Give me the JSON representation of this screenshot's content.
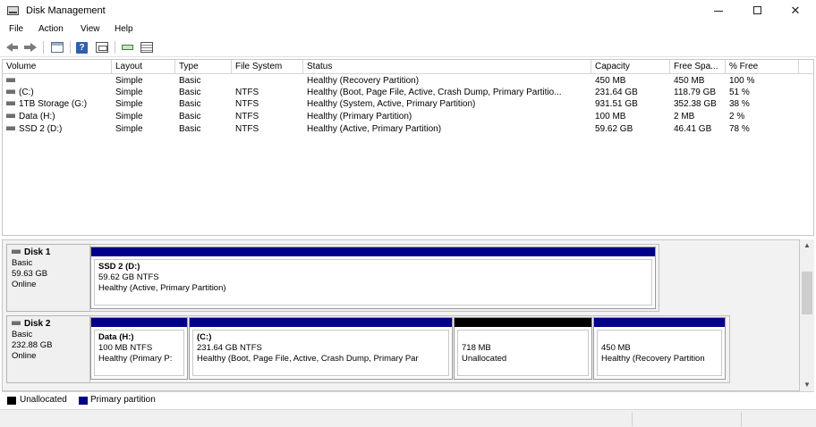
{
  "window": {
    "title": "Disk Management",
    "icons": [
      "disk-management-app-icon",
      "minimize-icon",
      "maximize-icon",
      "close-icon"
    ],
    "close_glyph": "✕"
  },
  "menu": [
    "File",
    "Action",
    "View",
    "Help"
  ],
  "toolbar": {
    "icons": [
      "back-arrow-icon",
      "forward-arrow-icon",
      "disk-list-icon",
      "help-icon",
      "properties-panel-icon",
      "connect-icon",
      "detail-list-icon"
    ],
    "help_glyph": "?"
  },
  "volume_table": {
    "columns": [
      "Volume",
      "Layout",
      "Type",
      "File System",
      "Status",
      "Capacity",
      "Free Spa...",
      "% Free"
    ],
    "rows": [
      {
        "volume": "",
        "layout": "Simple",
        "type": "Basic",
        "fs": "",
        "status": "Healthy (Recovery Partition)",
        "capacity": "450 MB",
        "free": "450 MB",
        "pct": "100 %"
      },
      {
        "volume": "(C:)",
        "layout": "Simple",
        "type": "Basic",
        "fs": "NTFS",
        "status": "Healthy (Boot, Page File, Active, Crash Dump, Primary Partitio...",
        "capacity": "231.64 GB",
        "free": "118.79 GB",
        "pct": "51 %"
      },
      {
        "volume": "1TB Storage (G:)",
        "layout": "Simple",
        "type": "Basic",
        "fs": "NTFS",
        "status": "Healthy (System, Active, Primary Partition)",
        "capacity": "931.51 GB",
        "free": "352.38 GB",
        "pct": "38 %"
      },
      {
        "volume": "Data (H:)",
        "layout": "Simple",
        "type": "Basic",
        "fs": "NTFS",
        "status": "Healthy (Primary Partition)",
        "capacity": "100 MB",
        "free": "2 MB",
        "pct": "2 %"
      },
      {
        "volume": "SSD 2 (D:)",
        "layout": "Simple",
        "type": "Basic",
        "fs": "NTFS",
        "status": "Healthy (Active, Primary Partition)",
        "capacity": "59.62 GB",
        "free": "46.41 GB",
        "pct": "78 %"
      }
    ]
  },
  "disks": [
    {
      "name": "Disk 1",
      "type": "Basic",
      "size": "59.63 GB",
      "state": "Online",
      "partitions": [
        {
          "title": "SSD 2  (D:)",
          "size_fs": "59.62 GB NTFS",
          "status": "Healthy (Active, Primary Partition)",
          "bar_color": "#00008b"
        }
      ]
    },
    {
      "name": "Disk 2",
      "type": "Basic",
      "size": "232.88 GB",
      "state": "Online",
      "partitions": [
        {
          "title": "Data  (H:)",
          "size_fs": "100 MB NTFS",
          "status": "Healthy (Primary P:",
          "bar_color": "#00008b"
        },
        {
          "title": "(C:)",
          "size_fs": "231.64 GB NTFS",
          "status": "Healthy (Boot, Page File, Active, Crash Dump, Primary Par",
          "bar_color": "#00008b"
        },
        {
          "title": "",
          "size_fs": "718 MB",
          "status": "Unallocated",
          "bar_color": "#000000"
        },
        {
          "title": "",
          "size_fs": "450 MB",
          "status": "Healthy (Recovery Partition",
          "bar_color": "#00008b"
        }
      ]
    }
  ],
  "scrollbar": {
    "up_glyph": "▲",
    "down_glyph": "▼"
  },
  "legend": [
    {
      "label": "Unallocated",
      "color": "#000000"
    },
    {
      "label": "Primary partition",
      "color": "#00008b"
    }
  ],
  "colors": {
    "primary_partition": "#00008b",
    "unallocated": "#000000"
  }
}
